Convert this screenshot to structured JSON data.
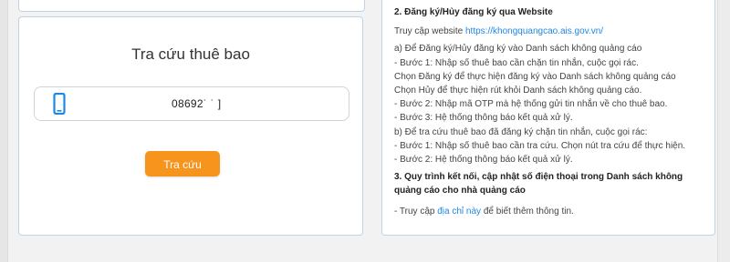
{
  "lookup": {
    "title": "Tra cứu thuê bao",
    "phone_value": "08692˙ ˙ ]",
    "button_label": "Tra cứu"
  },
  "info": {
    "section2_title": "2. Đăng ký/Hủy đăng ký qua Website",
    "visit_prefix": "Truy cập website ",
    "visit_link": "https://khongquangcao.ais.gov.vn/",
    "a_title": "a) Để Đăng ký/Hủy đăng ký vào Danh sách không quảng cáo",
    "a_step1": "- Bước 1: Nhập số thuê bao cần chặn tin nhắn, cuộc gọi rác.",
    "a_choose_register": "Chọn Đăng ký để thực hiện đăng ký vào Danh sách không quảng cáo",
    "a_choose_cancel": "Chọn Hủy để thực hiện rút khỏi Danh sách không quảng cáo.",
    "a_step2": "- Bước 2: Nhập mã OTP mà hệ thống gửi tin nhắn về cho thuê bao.",
    "a_step3": "- Bước 3: Hệ thống thông báo kết quả xử lý.",
    "b_title": "b) Để tra cứu thuê bao đã đăng ký chặn tin nhắn, cuộc gọi rác:",
    "b_step1": "- Bước 1: Nhập số thuê bao cần tra cứu. Chọn nút tra cứu để thực hiện.",
    "b_step2": "- Bước 2: Hệ thống thông báo kết quả xử lý.",
    "section3_title_line1": "3. Quy trình kết nối, cập nhật số điện thoại trong Danh sách không",
    "section3_title_line2": "quảng cáo cho nhà quảng cáo",
    "access_prefix": "- Truy cập ",
    "access_link": "địa chỉ này",
    "access_suffix": " để biết thêm thông tin."
  },
  "colors": {
    "accent_orange": "#f7941d",
    "link_blue": "#1e88e5",
    "card_border": "#bcd3e8",
    "phone_icon": "#1e88e5"
  },
  "icons": {
    "phone": "mobile-phone-icon"
  }
}
